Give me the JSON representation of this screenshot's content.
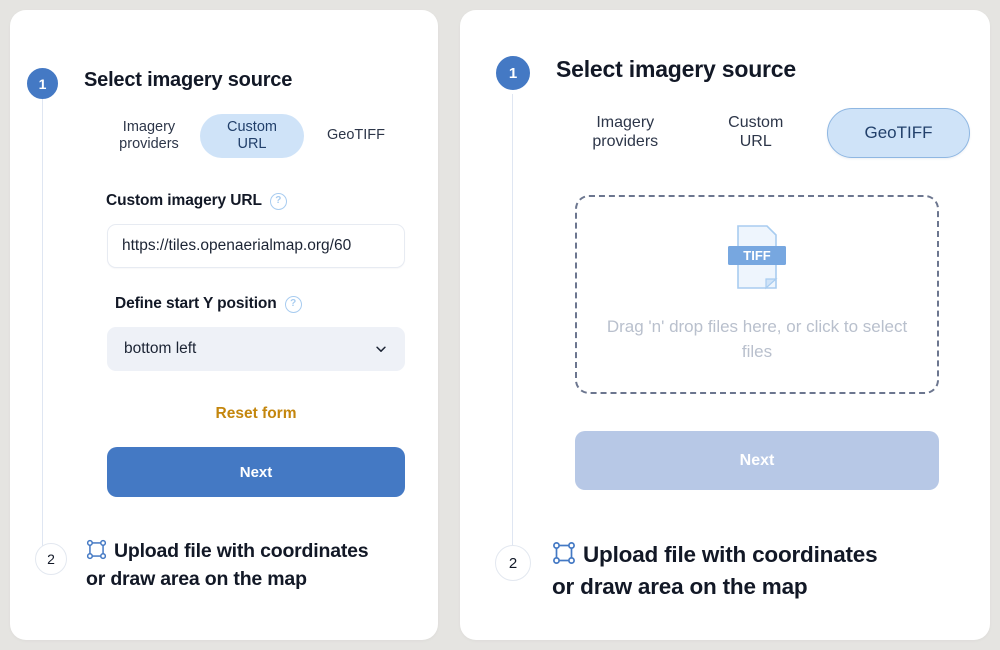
{
  "background_color": "#e5e4e1",
  "accent_color": "#4479c4",
  "selected_tab_color": "#cfe3f8",
  "reset_link_color": "#c4860d",
  "panels": [
    {
      "id": "custom-url-panel",
      "step1": {
        "number": "1",
        "title": "Select imagery source",
        "tabs": [
          {
            "label_line1": "Imagery",
            "label_line2": "providers",
            "selected": false
          },
          {
            "label_line1": "Custom",
            "label_line2": "URL",
            "selected": true
          },
          {
            "label_line1": "GeoTIFF",
            "label_line2": "",
            "selected": false
          }
        ],
        "fields": [
          {
            "label": "Custom imagery URL",
            "help": "?",
            "value": "https://tiles.openaerialmap.org/60"
          },
          {
            "label": "Define start Y position",
            "help": "?",
            "value": "bottom left"
          }
        ],
        "reset_label": "Reset form",
        "next_label": "Next",
        "next_enabled": true
      },
      "step2": {
        "number": "2",
        "icon": "bounding-box-icon",
        "line1": "Upload file with coordinates",
        "line2": "or draw area on the map"
      }
    },
    {
      "id": "geotiff-panel",
      "step1": {
        "number": "1",
        "title": "Select imagery source",
        "tabs": [
          {
            "label_line1": "Imagery",
            "label_line2": "providers",
            "selected": false
          },
          {
            "label_line1": "Custom",
            "label_line2": "URL",
            "selected": false
          },
          {
            "label_line1": "GeoTIFF",
            "label_line2": "",
            "selected": true
          }
        ],
        "dropzone": {
          "file_icon_label": "TIFF",
          "text": "Drag 'n' drop files here, or click to select files"
        },
        "next_label": "Next",
        "next_enabled": false
      },
      "step2": {
        "number": "2",
        "icon": "bounding-box-icon",
        "line1": "Upload file with coordinates",
        "line2": "or draw area on the map"
      }
    }
  ]
}
